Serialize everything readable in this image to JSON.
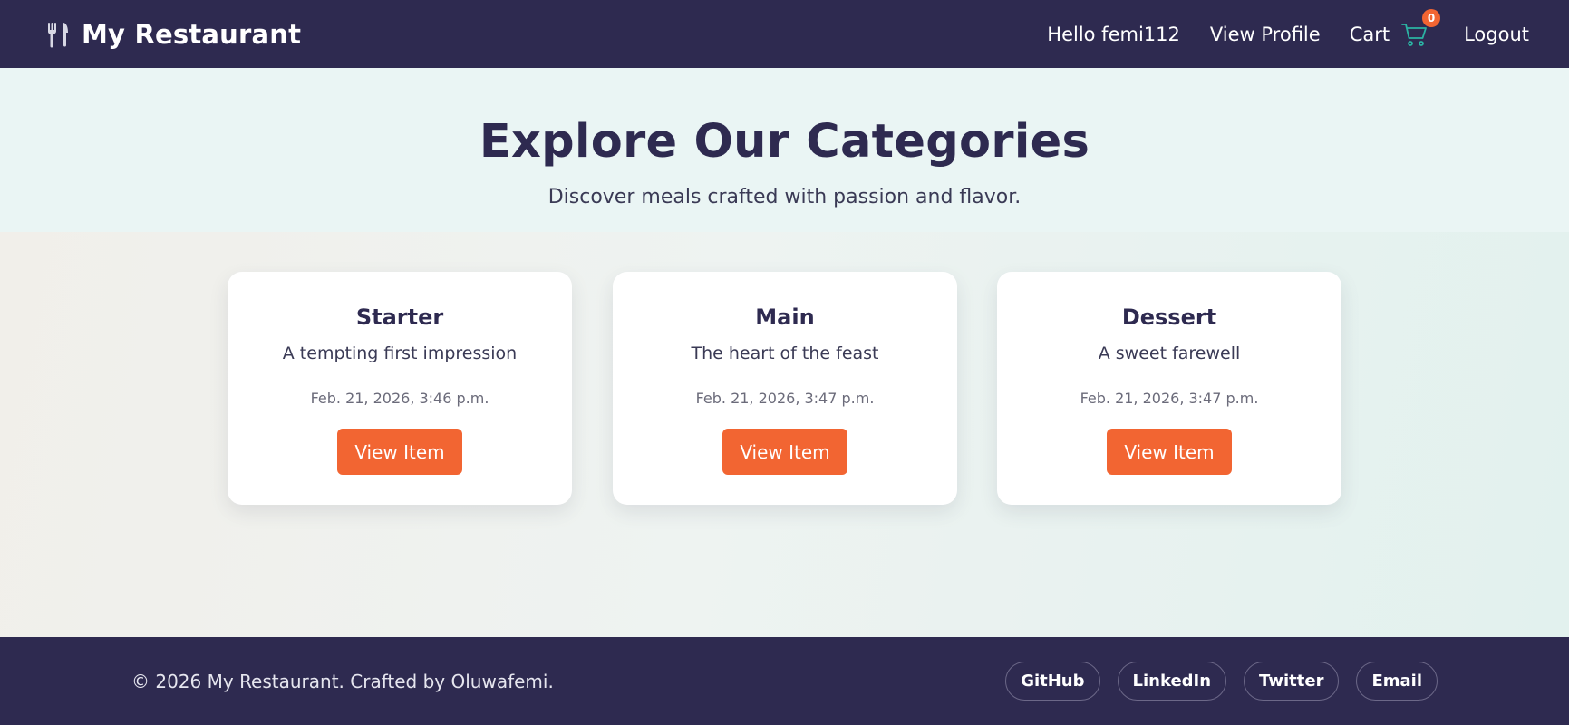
{
  "navbar": {
    "brand_icon": "fork-knife-icon",
    "brand": "My Restaurant",
    "greeting": "Hello femi112",
    "view_profile": "View Profile",
    "cart": "Cart",
    "cart_icon": "cart-icon",
    "cart_count": "0",
    "logout": "Logout"
  },
  "hero": {
    "title": "Explore Our Categories",
    "subtitle": "Discover meals crafted with passion and flavor."
  },
  "categories": [
    {
      "title": "Starter",
      "description": "A tempting first impression",
      "date": "Feb. 21, 2026, 3:46 p.m.",
      "button": "View Item"
    },
    {
      "title": "Main",
      "description": "The heart of the feast",
      "date": "Feb. 21, 2026, 3:47 p.m.",
      "button": "View Item"
    },
    {
      "title": "Dessert",
      "description": "A sweet farewell",
      "date": "Feb. 21, 2026, 3:47 p.m.",
      "button": "View Item"
    }
  ],
  "footer": {
    "copyright": "© 2026 My Restaurant. Crafted by Oluwafemi.",
    "links": [
      "GitHub",
      "LinkedIn",
      "Twitter",
      "Email"
    ]
  },
  "colors": {
    "navy": "#2e2a50",
    "accent": "#f26532",
    "card": "#ffffff",
    "cart_icon": "#2bb3a3"
  }
}
